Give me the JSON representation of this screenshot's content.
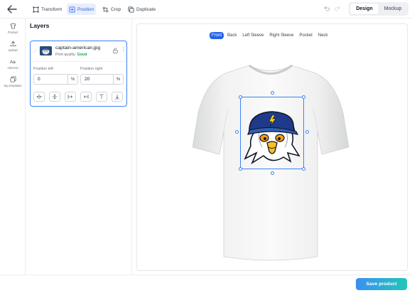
{
  "toolbar": {
    "items": [
      {
        "label": "Transform",
        "icon": "transform-icon"
      },
      {
        "label": "Position",
        "icon": "position-icon",
        "active": true
      },
      {
        "label": "Crop",
        "icon": "crop-icon"
      },
      {
        "label": "Duplicate",
        "icon": "duplicate-icon"
      }
    ],
    "modes": [
      "Design",
      "Mockup"
    ],
    "active_mode": "Design"
  },
  "rail": {
    "items": [
      {
        "label": "Product",
        "icon": "shirt-icon"
      },
      {
        "label": "Upload",
        "icon": "upload-icon"
      },
      {
        "label": "Add text",
        "icon": "text-icon"
      },
      {
        "label": "My templates",
        "icon": "templates-icon"
      }
    ]
  },
  "layers": {
    "title": "Layers",
    "layer": {
      "name": "captain-american.jpg",
      "quality_label": "Print quality:",
      "quality_value": "Good",
      "left_label": "Position left",
      "left_value": "0",
      "left_unit": "%",
      "right_label": "Position right",
      "right_value": "20",
      "right_unit": "%"
    }
  },
  "canvas": {
    "views": [
      "Front",
      "Back",
      "Left Sleeve",
      "Right Sleeve",
      "Pocket",
      "Neck"
    ],
    "active_view": "Front"
  },
  "footer": {
    "save_label": "Save product"
  },
  "colors": {
    "accent": "#2563eb",
    "quality_good": "#16a34a",
    "selection": "#3b82f6"
  }
}
